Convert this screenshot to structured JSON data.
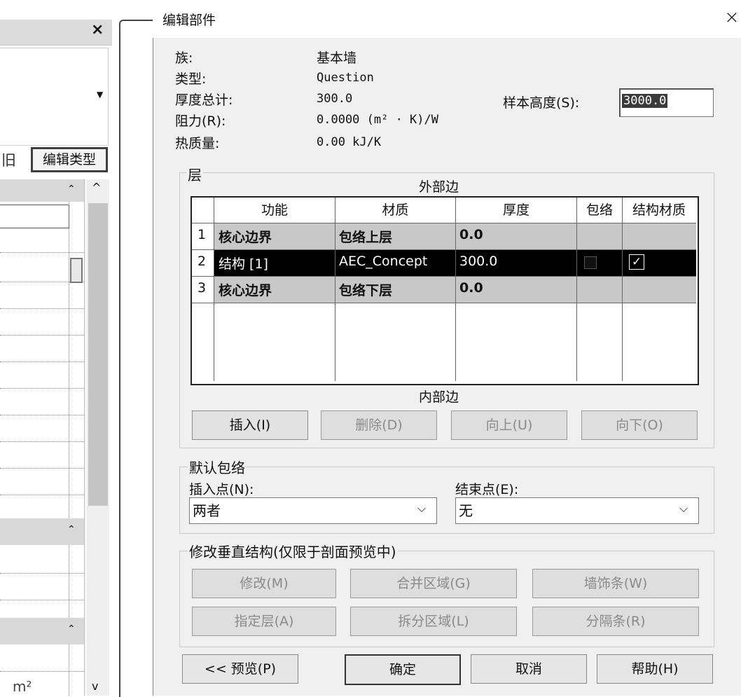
{
  "background_panel": {
    "close_glyph": "×",
    "edit_type_label": "编辑类型",
    "truncated_char": "旧",
    "unit_text": "m²"
  },
  "dialog": {
    "title": "编辑部件",
    "close_glyph": "×",
    "props": [
      {
        "label": "族:",
        "value": "基本墙"
      },
      {
        "label": "类型:",
        "value": "Question"
      },
      {
        "label": "厚度总计:",
        "value": "300.0"
      },
      {
        "label": "阻力(R):",
        "value": "0.0000 (m² · K)/W"
      },
      {
        "label": "热质量:",
        "value": "0.00 kJ/K"
      }
    ],
    "sample_height": {
      "label": "样本高度(S):",
      "value": "3000.0"
    },
    "layers": {
      "group_title": "层",
      "exterior_label": "外部边",
      "interior_label": "内部边",
      "columns": [
        "功能",
        "材质",
        "厚度",
        "包络",
        "结构材质"
      ],
      "rows": [
        {
          "num": "1",
          "function": "核心边界",
          "material": "包络上层",
          "thickness": "0.0",
          "wrap": false,
          "structural": false,
          "selected": false
        },
        {
          "num": "2",
          "function": "结构 [1]",
          "material": "AEC_Concept",
          "thickness": "300.0",
          "wrap": false,
          "structural": true,
          "selected": true
        },
        {
          "num": "3",
          "function": "核心边界",
          "material": "包络下层",
          "thickness": "0.0",
          "wrap": false,
          "structural": false,
          "selected": false
        }
      ],
      "buttons": {
        "insert": "插入(I)",
        "delete": "删除(D)",
        "up": "向上(U)",
        "down": "向下(O)"
      }
    },
    "default_wrap": {
      "group_title": "默认包络",
      "insert_label": "插入点(N):",
      "insert_value": "两者",
      "end_label": "结束点(E):",
      "end_value": "无"
    },
    "vertical": {
      "group_title": "修改垂直结构(仅限于剖面预览中)",
      "buttons": {
        "modify": "修改(M)",
        "merge": "合并区域(G)",
        "sweep": "墙饰条(W)",
        "assign": "指定层(A)",
        "split": "拆分区域(L)",
        "reveal": "分隔条(R)"
      }
    },
    "footer": {
      "preview": "<< 预览(P)",
      "ok": "确定",
      "cancel": "取消",
      "help": "帮助(H)"
    }
  },
  "colors": {
    "selected_row": "#000000",
    "core_row": "#c8c8c8",
    "dialog_bg": "#f0f0f0"
  }
}
